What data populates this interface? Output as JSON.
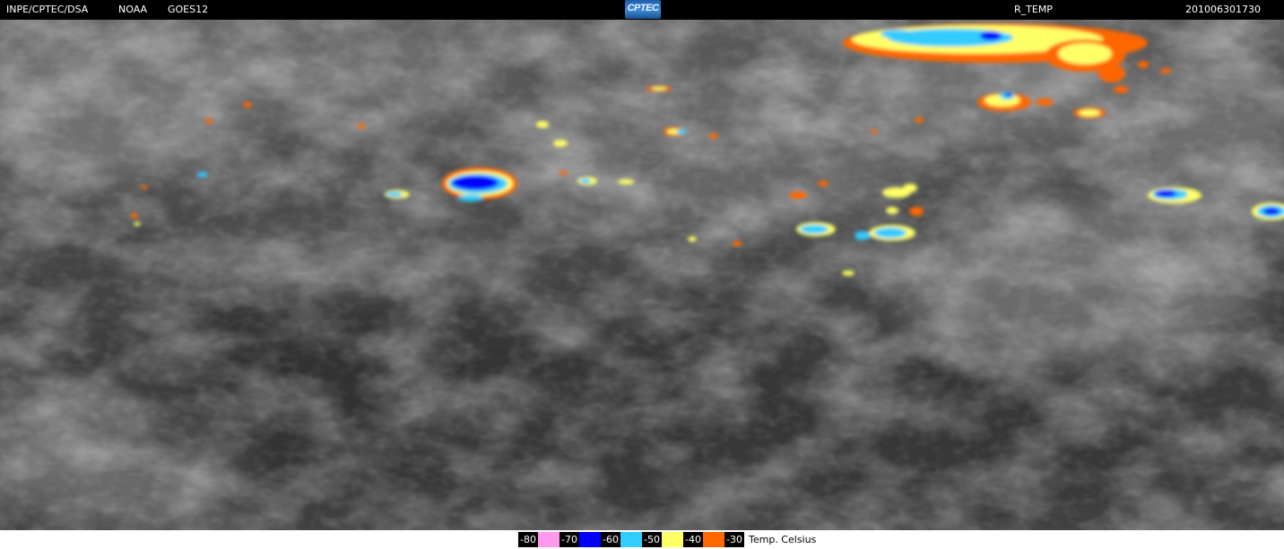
{
  "header": {
    "source": "INPE/CPTEC/DSA",
    "agency": "NOAA",
    "satellite": "GOES12",
    "logo_text": "CPTEC",
    "product": "R_TEMP",
    "timestamp": "201006301730"
  },
  "legend": {
    "items": [
      {
        "label": "-80",
        "color": "#ff99ee"
      },
      {
        "label": "-70",
        "color": "#0000ff"
      },
      {
        "label": "-60",
        "color": "#33ccff"
      },
      {
        "label": "-50",
        "color": "#ffff66"
      },
      {
        "label": "-40",
        "color": "#ff6600"
      },
      {
        "label": "-30",
        "color": ""
      }
    ],
    "units": "Temp. Celsius"
  },
  "image": {
    "icon": "satellite-infrared-image"
  }
}
